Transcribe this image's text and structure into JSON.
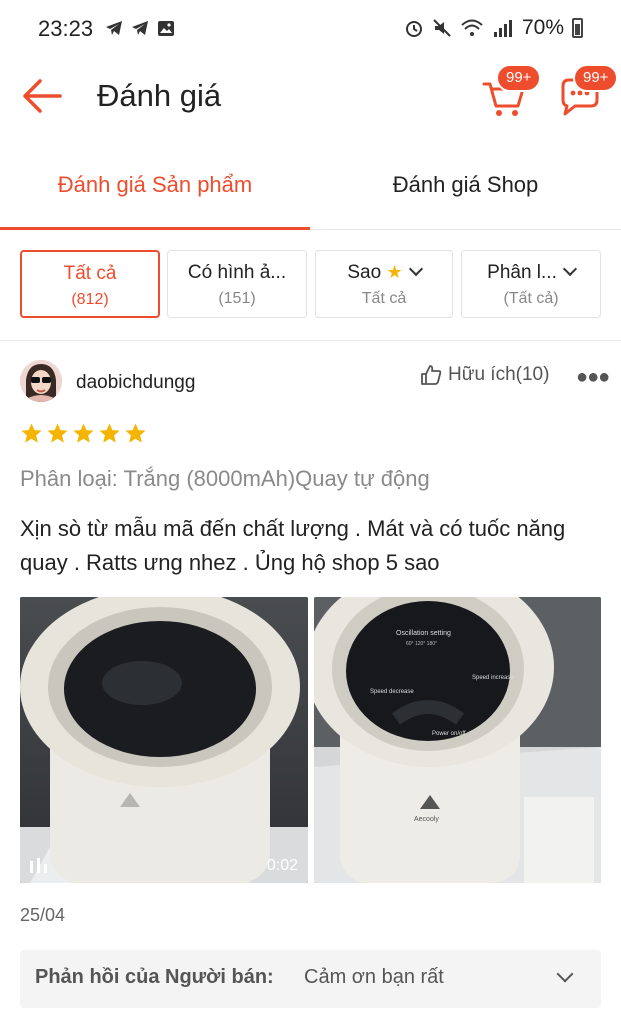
{
  "status_bar": {
    "time": "23:23",
    "battery": "70%",
    "left_icons": [
      "telegram-icon",
      "telegram-icon",
      "gallery-icon"
    ],
    "right_icons": [
      "alarm-icon",
      "mute-icon",
      "wifi-icon",
      "signal-icon",
      "battery-icon"
    ]
  },
  "header": {
    "title": "Đánh giá",
    "cart_badge": "99+",
    "chat_badge": "99+"
  },
  "tabs": [
    {
      "label": "Đánh giá Sản phẩm",
      "active": true
    },
    {
      "label": "Đánh giá Shop",
      "active": false
    }
  ],
  "filters": [
    {
      "label": "Tất cả",
      "sub": "(812)",
      "active": true
    },
    {
      "label": "Có hình ả...",
      "sub": "(151)",
      "active": false
    },
    {
      "label": "Sao",
      "sub": "Tất cả",
      "active": false
    },
    {
      "label": "Phân l...",
      "sub": "(Tất cả)",
      "active": false
    }
  ],
  "review": {
    "username": "daobichdungg",
    "helpful_label": "Hữu ích(10)",
    "rating": 5,
    "variant": "Phân loại: Trắng (8000mAh)Quay tự động",
    "text": "Xịn sò từ mẫu mã đến chất lượng . Mát và có tuốc năng quay . Ratts ưng nhez . Ủng hộ shop 5 sao",
    "video_duration": "0:02",
    "date": "25/04",
    "fan_screen": {
      "oscillation": "Oscillation setting",
      "angles": "60° 120° 180°",
      "speed_decrease": "Speed decrease",
      "speed_increase": "Speed increase",
      "power": "Power on/off",
      "brand": "Aecooly"
    },
    "seller_reply": {
      "label": "Phản hồi của Người bán:",
      "text": "Cảm ơn bạn rất"
    }
  },
  "colors": {
    "accent": "#ee4d2d",
    "star": "#f5b400"
  }
}
